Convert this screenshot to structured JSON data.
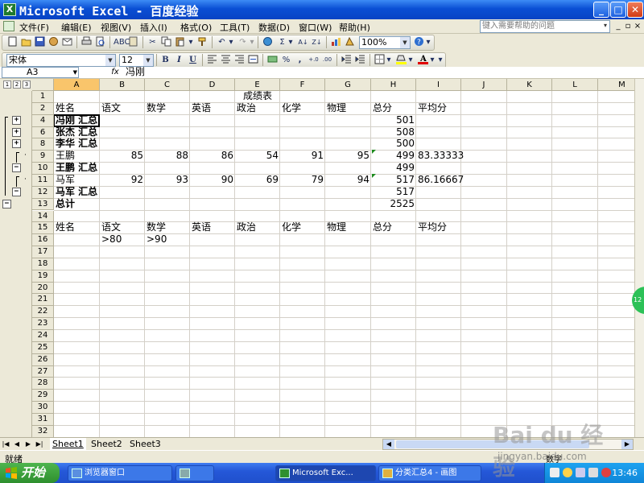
{
  "window": {
    "title": "Microsoft Excel - 百度经验",
    "app_icon": "excel-icon",
    "min_label": "_",
    "max_label": "□",
    "close_label": "✕"
  },
  "menu": {
    "items": [
      "文件(F)",
      "编辑(E)",
      "视图(V)",
      "插入(I)",
      "格式(O)",
      "工具(T)",
      "数据(D)",
      "窗口(W)",
      "帮助(H)"
    ],
    "help_placeholder": "键入需要帮助的问题",
    "help_drop": "▾",
    "doc_min": "_",
    "doc_restore": "▫",
    "doc_close": "×"
  },
  "toolbar": {
    "zoom": "100%",
    "font_name": "宋体",
    "font_size": "12",
    "bold": "B",
    "italic": "I",
    "underline": "U",
    "percent": "%",
    "comma": ",",
    "sigma": "Σ"
  },
  "formula_bar": {
    "name_box": "A3",
    "fx": "fx",
    "content": "冯刚"
  },
  "outline_levels": [
    "1",
    "2",
    "3"
  ],
  "columns": [
    "A",
    "B",
    "C",
    "D",
    "E",
    "F",
    "G",
    "H",
    "I",
    "J",
    "K",
    "L",
    "M"
  ],
  "active_column": "A",
  "rows": [
    "1",
    "2",
    "4",
    "6",
    "8",
    "9",
    "10",
    "11",
    "12",
    "13",
    "14",
    "15",
    "16",
    "17",
    "18",
    "19",
    "20",
    "21",
    "22",
    "23",
    "24",
    "25",
    "26",
    "27",
    "28",
    "29",
    "30",
    "31",
    "32"
  ],
  "outline_buttons": {
    "expand": "+",
    "collapse": "−",
    "dot": "·"
  },
  "cells": {
    "r1": {
      "E": "成绩表"
    },
    "r2": {
      "A": "姓名",
      "B": "语文",
      "C": "数学",
      "D": "英语",
      "E": "政治",
      "F": "化学",
      "G": "物理",
      "H": "总分",
      "I": "平均分"
    },
    "r4": {
      "A": "冯刚 汇总",
      "H": "501"
    },
    "r6": {
      "A": "张杰 汇总",
      "H": "508"
    },
    "r8": {
      "A": "李华 汇总",
      "H": "500"
    },
    "r9": {
      "A": "王鹏",
      "B": "85",
      "C": "88",
      "D": "86",
      "E": "54",
      "F": "91",
      "G": "95",
      "H": "499",
      "I": "83.33333"
    },
    "r10": {
      "A": "王鹏 汇总",
      "H": "499"
    },
    "r11": {
      "A": "马军",
      "B": "92",
      "C": "93",
      "D": "90",
      "E": "69",
      "F": "79",
      "G": "94",
      "H": "517",
      "I": "86.16667"
    },
    "r12": {
      "A": "马军 汇总",
      "H": "517"
    },
    "r13": {
      "A": "总计",
      "H": "2525"
    },
    "r15": {
      "A": "姓名",
      "B": "语文",
      "C": "数学",
      "D": "英语",
      "E": "政治",
      "F": "化学",
      "G": "物理",
      "H": "总分",
      "I": "平均分"
    },
    "r16": {
      "B": ">80",
      "C": ">90"
    }
  },
  "sheets": [
    "Sheet1",
    "Sheet2",
    "Sheet3"
  ],
  "active_sheet": "Sheet1",
  "sheet_nav": [
    "|◀",
    "◀",
    "▶",
    "▶|"
  ],
  "status": {
    "ready": "就绪",
    "mode": "数字"
  },
  "taskbar": {
    "start": "开始",
    "tasks": [
      "浏览器窗口",
      "",
      "Microsoft Exc...",
      "分类汇总4 - 画图"
    ],
    "clock": "13:46"
  },
  "side_badge": "12",
  "watermark": {
    "logo": "Bai du 经验",
    "url": "jingyan.baidu.com"
  },
  "colors": {
    "titlebar": "#0a4fd4",
    "active_header": "#f9c56b",
    "error_triangle": "#1c8a1c"
  }
}
